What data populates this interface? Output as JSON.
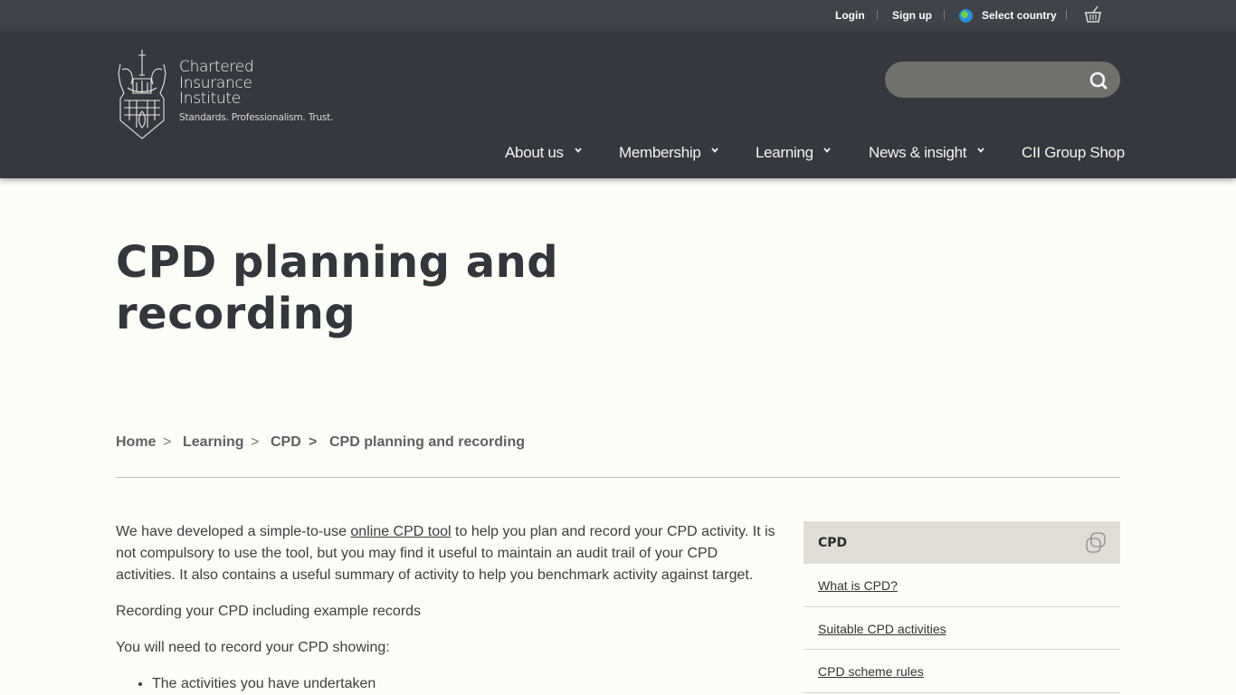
{
  "utility": {
    "login": "Login",
    "signup": "Sign up",
    "select_country": "Select country",
    "globe_icon": "globe-icon",
    "basket_icon": "basket-icon"
  },
  "logo": {
    "line1": "Chartered",
    "line2": "Insurance",
    "line3": "Institute",
    "tagline": "Standards. Professionalism. Trust."
  },
  "search": {
    "value": "",
    "placeholder": "",
    "icon": "search-icon"
  },
  "nav": {
    "items": [
      {
        "label": "About us",
        "has_dropdown": true
      },
      {
        "label": "Membership",
        "has_dropdown": true
      },
      {
        "label": "Learning",
        "has_dropdown": true
      },
      {
        "label": "News & insight",
        "has_dropdown": true
      },
      {
        "label": "CII Group Shop",
        "has_dropdown": false
      }
    ]
  },
  "page": {
    "title_line1": "CPD planning and",
    "title_line2": "recording"
  },
  "breadcrumb": {
    "items": [
      "Home",
      "Learning",
      "CPD",
      "CPD planning and recording"
    ],
    "separator": ">"
  },
  "content": {
    "p1_before": "We have developed a simple-to-use ",
    "p1_link": "online CPD tool",
    "p1_after": " to help you plan and record your CPD activity. It is not compulsory to use the tool, but you may find it useful to maintain an audit trail of your CPD activities. It also contains a useful summary of activity to help you benchmark activity against target.",
    "p2": "Recording your CPD including example records",
    "p3": "You will need to record your CPD showing:",
    "bullets": [
      "The activities you have undertaken"
    ]
  },
  "sidebar": {
    "title": "CPD",
    "icon": "copy-icon",
    "links": [
      "What is CPD?",
      "Suitable CPD activities",
      "CPD scheme rules"
    ]
  },
  "colors": {
    "utility_bg": "#3f4248",
    "header_bg": "#35383e",
    "page_bg": "#fdfdf8",
    "sidebar_head_bg": "#e0ddd7",
    "search_bg": "#70716d"
  }
}
